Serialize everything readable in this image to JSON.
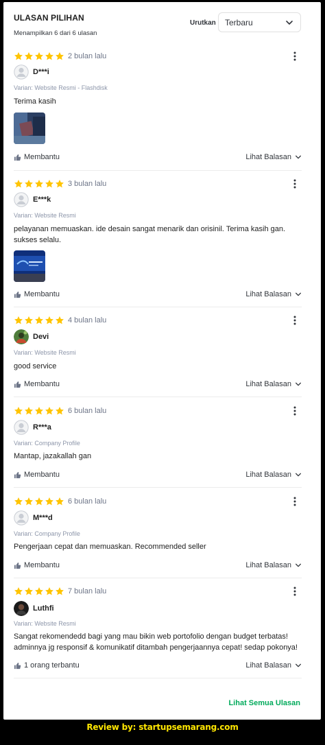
{
  "header": {
    "title": "ULASAN PILIHAN",
    "subtitle": "Menampilkan 6 dari 6 ulasan",
    "sort_label": "Urutkan",
    "sort_value": "Terbaru"
  },
  "colors": {
    "star": "#ffc400",
    "accent_green": "#00aa5b",
    "footer_text": "#ffe600"
  },
  "reviews": [
    {
      "rating": 5,
      "time": "2 bulan lalu",
      "user": "D***i",
      "variant": "Varian: Website Resmi - Flashdisk",
      "text": "Terima kasih",
      "has_image": true,
      "helpful": "Membantu",
      "replies": "Lihat Balasan"
    },
    {
      "rating": 5,
      "time": "3 bulan lalu",
      "user": "E***k",
      "variant": "Varian: Website Resmi",
      "text_line1": "pelayanan memuaskan. ide desain sangat menarik dan orisinil. Terima kasih gan.",
      "text_line2": "sukses selalu.",
      "has_image": true,
      "helpful": "Membantu",
      "replies": "Lihat Balasan"
    },
    {
      "rating": 5,
      "time": "4 bulan lalu",
      "user": "Devi",
      "variant": "Varian: Website Resmi",
      "text": "good service",
      "helpful": "Membantu",
      "replies": "Lihat Balasan"
    },
    {
      "rating": 5,
      "time": "6 bulan lalu",
      "user": "R***a",
      "variant": "Varian: Company Profile",
      "text": "Mantap, jazakallah gan",
      "helpful": "Membantu",
      "replies": "Lihat Balasan"
    },
    {
      "rating": 5,
      "time": "6 bulan lalu",
      "user": "M***d",
      "variant": "Varian: Company Profile",
      "text": "Pengerjaan cepat dan memuaskan. Recommended seller",
      "helpful": "Membantu",
      "replies": "Lihat Balasan"
    },
    {
      "rating": 5,
      "time": "7 bulan lalu",
      "user": "Luthfi",
      "variant": "Varian: Website Resmi",
      "text_line1": "Sangat rekomendedd bagi yang mau bikin web portofolio dengan budget terbatas!",
      "text_line2": "adminnya jg responsif & komunikatif ditambah pengerjaannya cepat! sedap pokonya!",
      "helpful": "1 orang terbantu",
      "replies": "Lihat Balasan"
    }
  ],
  "see_all": "Lihat Semua Ulasan",
  "footer": "Review by: startupsemarang.com"
}
